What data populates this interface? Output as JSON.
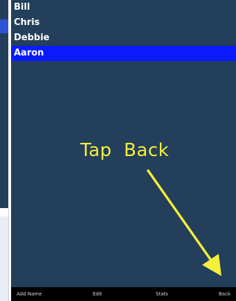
{
  "names": [
    "Bill",
    "Chris",
    "Debbie",
    "Aaron"
  ],
  "selected_name": "Aaron",
  "callout": {
    "text": "Tap  Back",
    "color": "#f4ef3b"
  },
  "toolbar": {
    "add_name_label": "Add Name",
    "edit_label": "Edit",
    "stats_label": "Stats",
    "back_label": "Back"
  },
  "colors": {
    "panel_background": "#233f5b",
    "selection": "#0a1cff",
    "toolbar_background": "#000000"
  }
}
